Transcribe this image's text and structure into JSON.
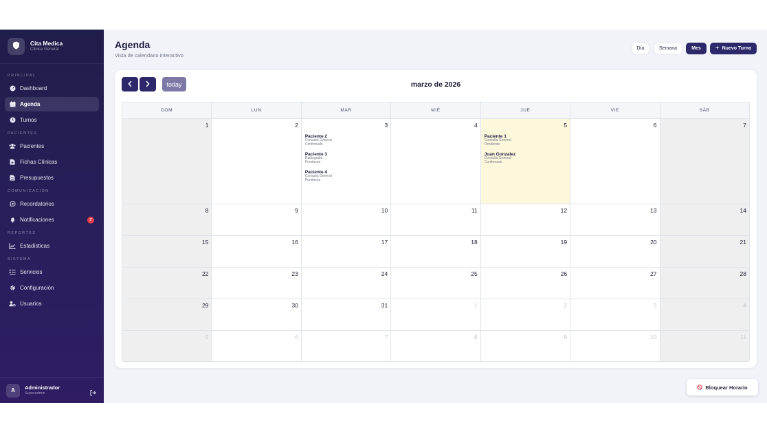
{
  "brand": {
    "title": "Cita Medica",
    "subtitle": "Clínica General"
  },
  "sidebar": {
    "sections": [
      {
        "label": "PRINCIPAL",
        "items": [
          {
            "label": "Dashboard",
            "icon": "dashboard-icon",
            "active": false
          },
          {
            "label": "Agenda",
            "icon": "calendar-icon",
            "active": true
          },
          {
            "label": "Turnos",
            "icon": "clock-icon",
            "active": false
          }
        ]
      },
      {
        "label": "PACIENTES",
        "items": [
          {
            "label": "Pacientes",
            "icon": "users-icon",
            "active": false
          },
          {
            "label": "Fichas Clínicas",
            "icon": "file-medical-icon",
            "active": false
          },
          {
            "label": "Presupuestos",
            "icon": "file-invoice-icon",
            "active": false
          }
        ]
      },
      {
        "label": "COMUNICACIÓN",
        "items": [
          {
            "label": "Recordatorios",
            "icon": "whatsapp-icon",
            "active": false
          },
          {
            "label": "Notificaciones",
            "icon": "bell-icon",
            "active": false,
            "badge": "7"
          }
        ]
      },
      {
        "label": "REPORTES",
        "items": [
          {
            "label": "Estadísticas",
            "icon": "chart-line-icon",
            "active": false
          }
        ]
      },
      {
        "label": "SISTEMA",
        "items": [
          {
            "label": "Servicios",
            "icon": "list-check-icon",
            "active": false
          },
          {
            "label": "Configuración",
            "icon": "gear-icon",
            "active": false
          },
          {
            "label": "Usuarios",
            "icon": "user-gear-icon",
            "active": false
          }
        ]
      }
    ]
  },
  "user": {
    "initial": "A",
    "name": "Administrador",
    "role": "Superadmin"
  },
  "header": {
    "title": "Agenda",
    "subtitle": "Vista de calendario interactivo"
  },
  "views": [
    {
      "label": "Día",
      "active": false
    },
    {
      "label": "Semana",
      "active": false
    },
    {
      "label": "Mes",
      "active": true
    }
  ],
  "new_button": {
    "label": "Nuevo Turno"
  },
  "calendar": {
    "today_label": "today",
    "month_title": "marzo de 2026",
    "weekdays": [
      "DOM",
      "LUN",
      "MAR",
      "MIÉ",
      "JUE",
      "VIE",
      "SÁB"
    ],
    "weeks": [
      [
        {
          "day": "1",
          "other": false
        },
        {
          "day": "2",
          "other": false
        },
        {
          "day": "3",
          "other": false,
          "events": [
            {
              "name": "Paciente 2",
              "service": "Consulta General",
              "status": "Confirmado"
            },
            {
              "name": "Paciente 3",
              "service": "Radiografia",
              "status": "Pendiente"
            },
            {
              "name": "Paciente 4",
              "service": "Consulta General",
              "status": "Pendiente"
            }
          ]
        },
        {
          "day": "4",
          "other": false
        },
        {
          "day": "5",
          "other": false,
          "today": true,
          "events": [
            {
              "name": "Paciente 1",
              "service": "Consulta General",
              "status": "Pendiente"
            },
            {
              "name": "Juan Gonzalez",
              "service": "Consulta General",
              "status": "Confirmado"
            }
          ]
        },
        {
          "day": "6",
          "other": false
        },
        {
          "day": "7",
          "other": false
        }
      ],
      [
        {
          "day": "8"
        },
        {
          "day": "9"
        },
        {
          "day": "10"
        },
        {
          "day": "11"
        },
        {
          "day": "12"
        },
        {
          "day": "13"
        },
        {
          "day": "14"
        }
      ],
      [
        {
          "day": "15"
        },
        {
          "day": "16"
        },
        {
          "day": "17"
        },
        {
          "day": "18"
        },
        {
          "day": "19"
        },
        {
          "day": "20"
        },
        {
          "day": "21"
        }
      ],
      [
        {
          "day": "22"
        },
        {
          "day": "23"
        },
        {
          "day": "24"
        },
        {
          "day": "25"
        },
        {
          "day": "26"
        },
        {
          "day": "27"
        },
        {
          "day": "28"
        }
      ],
      [
        {
          "day": "29"
        },
        {
          "day": "30"
        },
        {
          "day": "31"
        },
        {
          "day": "1",
          "other": true
        },
        {
          "day": "2",
          "other": true
        },
        {
          "day": "3",
          "other": true
        },
        {
          "day": "4",
          "other": true
        }
      ],
      [
        {
          "day": "5",
          "other": true
        },
        {
          "day": "6",
          "other": true
        },
        {
          "day": "7",
          "other": true
        },
        {
          "day": "8",
          "other": true
        },
        {
          "day": "9",
          "other": true
        },
        {
          "day": "10",
          "other": true
        },
        {
          "day": "11",
          "other": true
        }
      ]
    ]
  },
  "block_button": {
    "label": "Bloquear Horario"
  },
  "colors": {
    "primary": "#2c2869",
    "sidebar_bg": "#231f52",
    "today_bg": "#fdf7dc",
    "badge": "#e53e4d",
    "weekend_bg": "#efefef"
  }
}
